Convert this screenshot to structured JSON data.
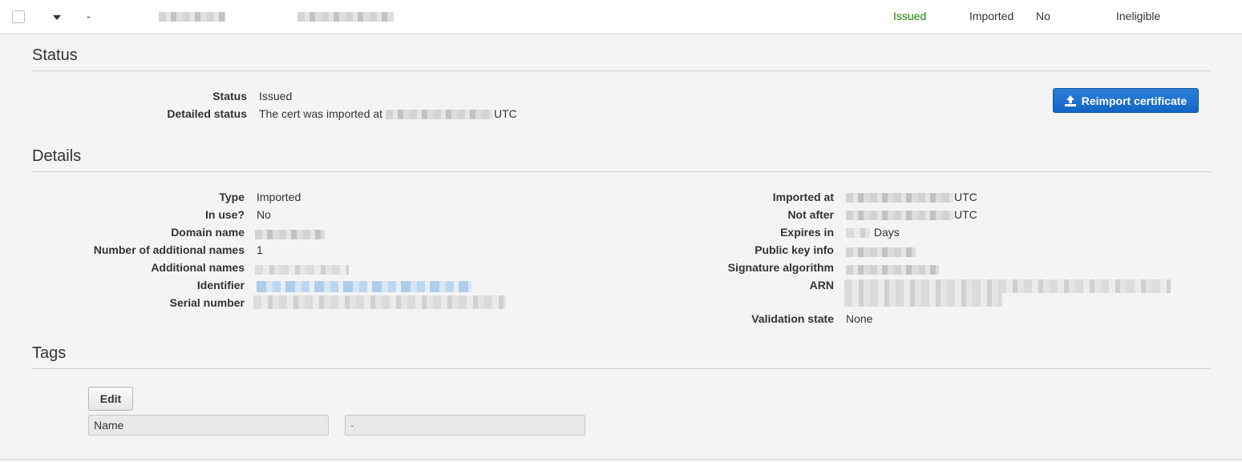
{
  "row": {
    "dash": "-",
    "status": "Issued",
    "type": "Imported",
    "in_use": "No",
    "renewal": "Ineligible"
  },
  "status_section": {
    "title": "Status",
    "status_label": "Status",
    "status_value": "Issued",
    "detailed_label": "Detailed status",
    "detailed_prefix": "The cert was imported at",
    "detailed_suffix": "UTC",
    "reimport_label": "Reimport certificate"
  },
  "details": {
    "title": "Details",
    "left": {
      "type_label": "Type",
      "type_value": "Imported",
      "inuse_label": "In use?",
      "inuse_value": "No",
      "domain_label": "Domain name",
      "numadd_label": "Number of additional names",
      "numadd_value": "1",
      "addnames_label": "Additional names",
      "identifier_label": "Identifier",
      "serial_label": "Serial number"
    },
    "right": {
      "imported_label": "Imported at",
      "imported_suffix": "UTC",
      "notafter_label": "Not after",
      "notafter_suffix": "UTC",
      "expires_label": "Expires in",
      "expires_suffix": "Days",
      "pubkey_label": "Public key info",
      "sigalg_label": "Signature algorithm",
      "arn_label": "ARN",
      "validation_label": "Validation state",
      "validation_value": "None"
    }
  },
  "tags": {
    "title": "Tags",
    "edit_label": "Edit",
    "name_field": "Name",
    "value_field": "-"
  },
  "colors": {
    "status_green": "#1d8102",
    "primary_blue": "#1266c4"
  }
}
